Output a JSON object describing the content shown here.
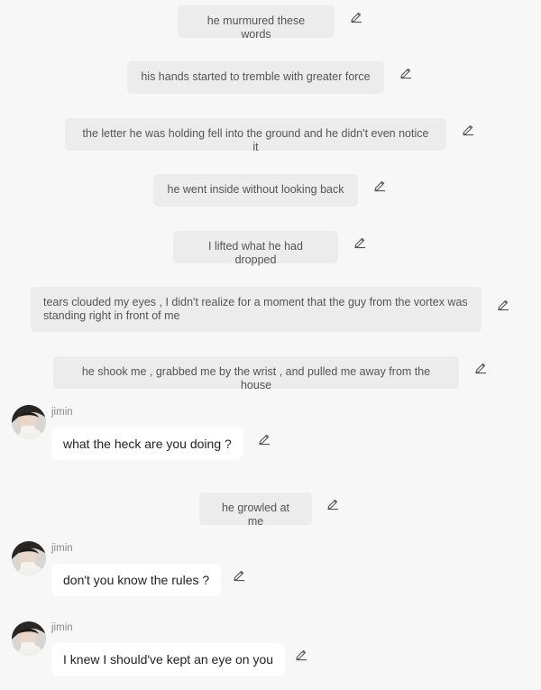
{
  "narration": [
    {
      "text": "he murmured these words"
    },
    {
      "text": "his hands started to tremble with greater force"
    },
    {
      "text": "the letter he was holding fell into the ground  and he didn't even notice it"
    },
    {
      "text": "he went inside without looking back"
    },
    {
      "text": "I lifted what he had dropped"
    },
    {
      "text": "tears clouded my eyes , I didn't realize for a moment  that the guy from the vortex was standing  right in front of me"
    },
    {
      "text": "he shook me , grabbed me by the wrist ,  and pulled me away from the house"
    },
    {
      "text": "he growled at me"
    }
  ],
  "messages": [
    {
      "sender": "jimin",
      "text": "what the heck are you doing  ?"
    },
    {
      "sender": "jimin",
      "text": "don't you know the rules ?"
    },
    {
      "sender": "jimin",
      "text": "I knew I should've kept an eye on you"
    }
  ],
  "icons": {
    "edit": "pencil-icon",
    "avatar": "avatar"
  }
}
